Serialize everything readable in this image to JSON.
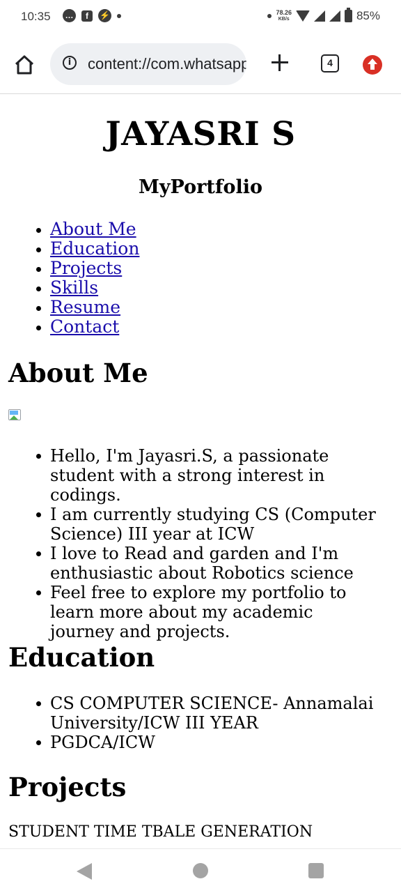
{
  "status_bar": {
    "time": "10:35",
    "net_speed_value": "78.26",
    "net_speed_unit": "KB/s",
    "battery_percent": "85%"
  },
  "browser": {
    "url": "content://com.whatsapp.provider.media/item/",
    "tab_count": "4",
    "info_glyph": "i"
  },
  "page": {
    "title": "JAYASRI S",
    "subtitle": "MyPortfolio",
    "nav_links": [
      "About Me",
      "Education",
      "Projects",
      "Skills",
      "Resume",
      "Contact"
    ],
    "about": {
      "heading": "About Me",
      "items": [
        "Hello, I'm Jayasri.S, a passionate student with a strong interest in codings.",
        "I am currently studying CS (Computer Science) III year at ICW",
        "I love to Read and garden and I'm enthusiastic about Robotics science",
        "Feel free to explore my portfolio to learn more about my academic journey and projects."
      ]
    },
    "education": {
      "heading": "Education",
      "items": [
        "CS COMPUTER SCIENCE- Annamalai University/ICW III YEAR",
        "PGDCA/ICW"
      ]
    },
    "projects": {
      "heading": "Projects",
      "text": "STUDENT TIME TBALE GENERATION"
    }
  },
  "colors": {
    "link": "#1a0dab",
    "update_badge": "#d93025",
    "url_bar_bg": "#eef0f3"
  },
  "icons": [
    "message-icon",
    "facebook-icon",
    "messenger-icon",
    "wifi-icon",
    "signal-icon",
    "battery-icon",
    "home-icon",
    "info-icon",
    "plus-icon",
    "tab-switcher-icon",
    "update-icon",
    "broken-image-icon",
    "back-icon",
    "home-circle-icon",
    "recents-icon"
  ]
}
